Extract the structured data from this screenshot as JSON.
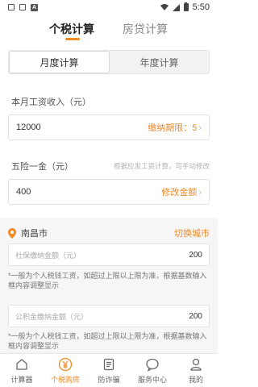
{
  "status_bar": {
    "time": "5:50"
  },
  "top_tabs": [
    {
      "label": "个税计算",
      "active": true
    },
    {
      "label": "房贷计算",
      "active": false
    }
  ],
  "segment": [
    {
      "label": "月度计算",
      "active": true
    },
    {
      "label": "年度计算",
      "active": false
    }
  ],
  "income": {
    "label": "本月工资收入（元）",
    "value": "12000",
    "period_label": "缴纳期限：5"
  },
  "insurance": {
    "label": "五险一金（元）",
    "hint": "根据应发工资计算，可手动修改",
    "value": "400",
    "action": "修改金额"
  },
  "city": {
    "name": "南昌市",
    "switch_label": "切换城市"
  },
  "social_security": {
    "placeholder": "社保缴纳金额（元）",
    "value": "200",
    "note": "*一般为个人税钱工资，如超过上限以上限为准，根据基数输入框内容调整显示"
  },
  "housing_fund": {
    "placeholder": "公积金缴纳金额（元）",
    "value": "200",
    "note": "*一般为个人税钱工资，如超过上限以上限为准，根据基数输入框内容调整显示"
  },
  "bottom_nav": [
    {
      "label": "计算器",
      "icon": "home-icon",
      "active": false
    },
    {
      "label": "个税购房",
      "icon": "yen-icon",
      "active": true
    },
    {
      "label": "防诈骗",
      "icon": "document-icon",
      "active": false
    },
    {
      "label": "服务中心",
      "icon": "chat-icon",
      "active": false
    },
    {
      "label": "我的",
      "icon": "user-icon",
      "active": false
    }
  ],
  "colors": {
    "accent": "#f08a24",
    "text": "#333333",
    "muted": "#aaaaaa"
  }
}
